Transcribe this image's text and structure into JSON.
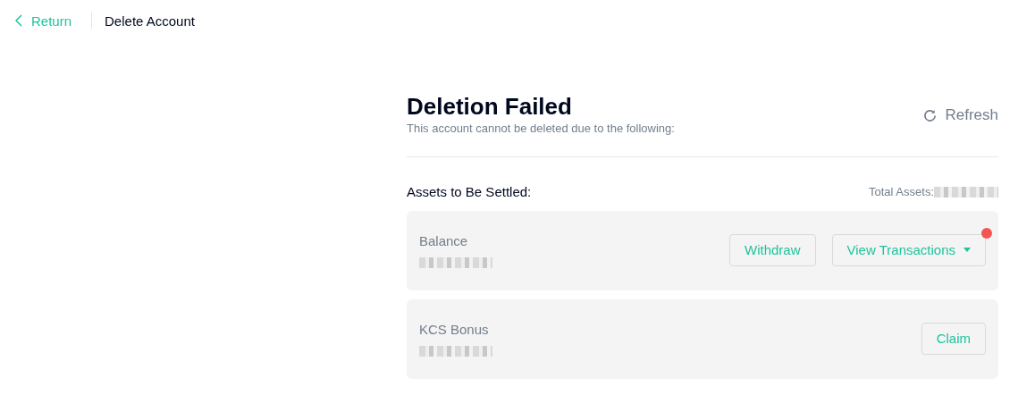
{
  "header": {
    "back_link": "Return",
    "title": "Delete Account"
  },
  "status": {
    "title": "Deletion Failed",
    "message": "This account cannot be deleted due to the following:",
    "refresh": "Refresh"
  },
  "assets": {
    "heading": "Assets to Be Settled:",
    "total_label": "Total Assets:",
    "items": [
      {
        "name": "Balance",
        "buttons": [
          {
            "label": "Withdraw",
            "dropdown": false,
            "notification": false
          },
          {
            "label": "View Transactions",
            "dropdown": true,
            "notification": true
          }
        ]
      },
      {
        "name": "KCS Bonus",
        "buttons": [
          {
            "label": "Claim",
            "dropdown": false,
            "notification": false
          }
        ]
      }
    ]
  }
}
